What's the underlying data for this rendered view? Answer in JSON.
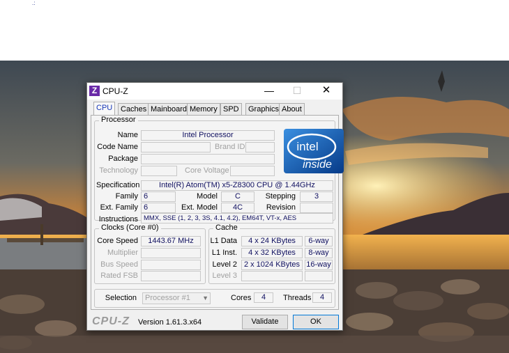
{
  "window": {
    "title": "CPU-Z",
    "minimize": "—",
    "maximize": "☐",
    "close": "✕"
  },
  "tabs": [
    "CPU",
    "Caches",
    "Mainboard",
    "Memory",
    "SPD",
    "Graphics",
    "About"
  ],
  "processor": {
    "group_label": "Processor",
    "name_label": "Name",
    "name": "Intel Processor",
    "code_name_label": "Code Name",
    "code_name": "",
    "brand_id_label": "Brand ID",
    "brand_id": "",
    "package_label": "Package",
    "package": "",
    "technology_label": "Technology",
    "technology": "",
    "core_voltage_label": "Core Voltage",
    "core_voltage": "",
    "specification_label": "Specification",
    "specification": "Intel(R) Atom(TM) x5-Z8300  CPU @ 1.44GHz",
    "family_label": "Family",
    "family": "6",
    "model_label": "Model",
    "model": "C",
    "stepping_label": "Stepping",
    "stepping": "3",
    "ext_family_label": "Ext. Family",
    "ext_family": "6",
    "ext_model_label": "Ext. Model",
    "ext_model": "4C",
    "revision_label": "Revision",
    "revision": "",
    "instructions_label": "Instructions",
    "instructions": "MMX, SSE (1, 2, 3, 3S, 4.1, 4.2), EM64T, VT-x, AES",
    "logo": {
      "line1": "intel",
      "line2": "inside"
    }
  },
  "clocks": {
    "group_label": "Clocks (Core #0)",
    "core_speed_label": "Core Speed",
    "core_speed": "1443.67 MHz",
    "multiplier_label": "Multiplier",
    "multiplier": "",
    "bus_speed_label": "Bus Speed",
    "bus_speed": "",
    "rated_fsb_label": "Rated FSB",
    "rated_fsb": ""
  },
  "cache": {
    "group_label": "Cache",
    "l1_data_label": "L1 Data",
    "l1_data": "4 x 24 KBytes",
    "l1_data_way": "6-way",
    "l1_inst_label": "L1 Inst.",
    "l1_inst": "4 x 32 KBytes",
    "l1_inst_way": "8-way",
    "level2_label": "Level 2",
    "level2": "2 x 1024 KBytes",
    "level2_way": "16-way",
    "level3_label": "Level 3",
    "level3": "",
    "level3_way": ""
  },
  "selection": {
    "label": "Selection",
    "value": "Processor #1",
    "cores_label": "Cores",
    "cores": "4",
    "threads_label": "Threads",
    "threads": "4"
  },
  "footer": {
    "brand": "CPU-Z",
    "version": "Version 1.61.3.x64",
    "validate": "Validate",
    "ok": "OK"
  },
  "colors": {
    "accent": "#1838b8",
    "value_text": "#101060",
    "intel_blue": "#0a5ab4"
  }
}
